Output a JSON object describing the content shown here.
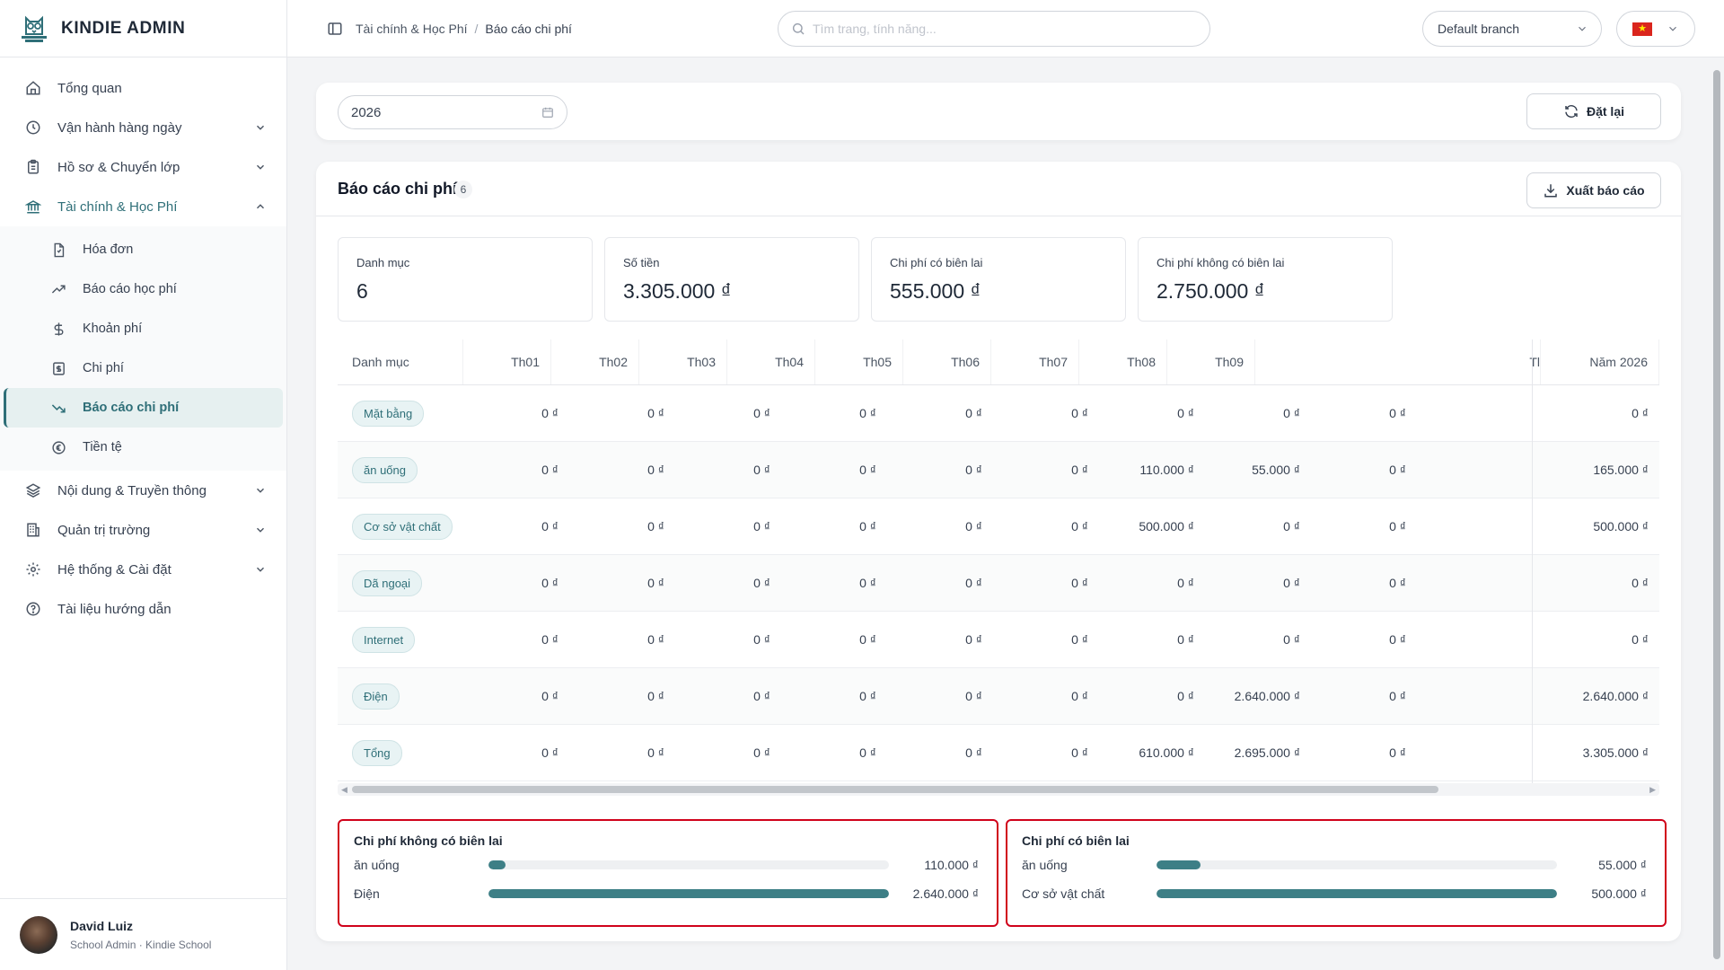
{
  "app": {
    "name": "KINDIE ADMIN"
  },
  "sidebar": {
    "items": [
      {
        "label": "Tổng quan",
        "icon": "home-icon"
      },
      {
        "label": "Vận hành hàng ngày",
        "icon": "clock-icon"
      },
      {
        "label": "Hồ sơ & Chuyển lớp",
        "icon": "clipboard-icon"
      },
      {
        "label": "Tài chính & Học Phí",
        "icon": "bank-icon"
      },
      {
        "label": "Nội dung & Truyền thông",
        "icon": "layers-icon"
      },
      {
        "label": "Quản trị trường",
        "icon": "building-icon"
      },
      {
        "label": "Hệ thống & Cài đặt",
        "icon": "gear-icon"
      },
      {
        "label": "Tài liệu hướng dẫn",
        "icon": "help-circle-icon"
      }
    ],
    "finance_sub": [
      {
        "label": "Hóa đơn",
        "icon": "invoice-icon"
      },
      {
        "label": "Báo cáo học phí",
        "icon": "trend-up-icon"
      },
      {
        "label": "Khoản phí",
        "icon": "dollar-icon"
      },
      {
        "label": "Chi phí",
        "icon": "receipt-icon"
      },
      {
        "label": "Báo cáo chi phí",
        "icon": "trend-down-icon"
      },
      {
        "label": "Tiền tệ",
        "icon": "currency-icon"
      }
    ]
  },
  "user": {
    "name": "David Luiz",
    "role": "School Admin · Kindie School"
  },
  "breadcrumb": {
    "parent": "Tài chính & Học Phí",
    "current": "Báo cáo chi phí"
  },
  "search": {
    "placeholder": "Tìm trang, tính năng..."
  },
  "branch": {
    "value": "Default branch"
  },
  "filter": {
    "year": "2026",
    "reset_label": "Đặt lại"
  },
  "report": {
    "title": "Báo cáo chi phí",
    "count": "6",
    "export_label": "Xuất báo cáo",
    "stats": [
      {
        "label": "Danh mục",
        "value": "6"
      },
      {
        "label": "Số tiền",
        "value": "3.305.000 ₫"
      },
      {
        "label": "Chi phí có biên lai",
        "value": "555.000 ₫"
      },
      {
        "label": "Chi phí không có biên lai",
        "value": "2.750.000 ₫"
      }
    ],
    "columns": [
      "Danh mục",
      "Th01",
      "Th02",
      "Th03",
      "Th04",
      "Th05",
      "Th06",
      "Th07",
      "Th08",
      "Th09",
      "Tl",
      "Năm 2026"
    ],
    "rows": [
      {
        "category": "Mặt bằng",
        "values": [
          "0 ₫",
          "0 ₫",
          "0 ₫",
          "0 ₫",
          "0 ₫",
          "0 ₫",
          "0 ₫",
          "0 ₫",
          "0 ₫"
        ],
        "total": "0 ₫"
      },
      {
        "category": "ăn uống",
        "values": [
          "0 ₫",
          "0 ₫",
          "0 ₫",
          "0 ₫",
          "0 ₫",
          "0 ₫",
          "110.000 ₫",
          "55.000 ₫",
          "0 ₫"
        ],
        "total": "165.000 ₫"
      },
      {
        "category": "Cơ sở vật chất",
        "values": [
          "0 ₫",
          "0 ₫",
          "0 ₫",
          "0 ₫",
          "0 ₫",
          "0 ₫",
          "500.000 ₫",
          "0 ₫",
          "0 ₫"
        ],
        "total": "500.000 ₫"
      },
      {
        "category": "Dã ngoại",
        "values": [
          "0 ₫",
          "0 ₫",
          "0 ₫",
          "0 ₫",
          "0 ₫",
          "0 ₫",
          "0 ₫",
          "0 ₫",
          "0 ₫"
        ],
        "total": "0 ₫"
      },
      {
        "category": "Internet",
        "values": [
          "0 ₫",
          "0 ₫",
          "0 ₫",
          "0 ₫",
          "0 ₫",
          "0 ₫",
          "0 ₫",
          "0 ₫",
          "0 ₫"
        ],
        "total": "0 ₫"
      },
      {
        "category": "Điện",
        "values": [
          "0 ₫",
          "0 ₫",
          "0 ₫",
          "0 ₫",
          "0 ₫",
          "0 ₫",
          "0 ₫",
          "2.640.000 ₫",
          "0 ₫"
        ],
        "total": "2.640.000 ₫"
      },
      {
        "category": "Tổng",
        "values": [
          "0 ₫",
          "0 ₫",
          "0 ₫",
          "0 ₫",
          "0 ₫",
          "0 ₫",
          "610.000 ₫",
          "2.695.000 ₫",
          "0 ₫"
        ],
        "total": "3.305.000 ₫"
      }
    ],
    "no_receipt": {
      "title": "Chi phí không có biên lai",
      "items": [
        {
          "label": "ăn uống",
          "value": "110.000 ₫",
          "fraction": 0.0417
        },
        {
          "label": "Điện",
          "value": "2.640.000 ₫",
          "fraction": 1.0
        }
      ]
    },
    "with_receipt": {
      "title": "Chi phí có biên lai",
      "items": [
        {
          "label": "ăn uống",
          "value": "55.000 ₫",
          "fraction": 0.11
        },
        {
          "label": "Cơ sở vật chất",
          "value": "500.000 ₫",
          "fraction": 1.0
        }
      ]
    }
  },
  "colors": {
    "accent": "#2f6f78",
    "bar": "#3d7f86",
    "highlight": "#d0021b"
  }
}
